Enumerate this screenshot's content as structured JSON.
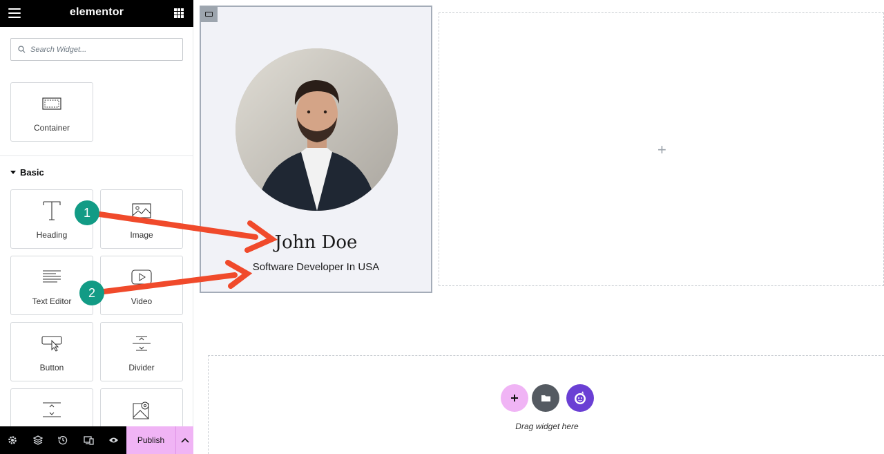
{
  "app": {
    "brand": "elementor"
  },
  "search": {
    "placeholder": "Search Widget..."
  },
  "layout_tiles": [
    {
      "label": "Container",
      "icon": "container-icon"
    }
  ],
  "basic_section": {
    "title": "Basic",
    "tiles": [
      {
        "label": "Heading",
        "icon": "heading-icon"
      },
      {
        "label": "Image",
        "icon": "image-icon"
      },
      {
        "label": "Text Editor",
        "icon": "text-editor-icon"
      },
      {
        "label": "Video",
        "icon": "video-icon"
      },
      {
        "label": "Button",
        "icon": "button-icon"
      },
      {
        "label": "Divider",
        "icon": "divider-icon"
      },
      {
        "label": "",
        "icon": "spacer-icon"
      },
      {
        "label": "",
        "icon": "google-maps-icon"
      }
    ]
  },
  "bottom_bar": {
    "icons": [
      "settings-icon",
      "navigator-icon",
      "history-icon",
      "responsive-icon",
      "preview-icon"
    ],
    "publish_label": "Publish"
  },
  "canvas": {
    "card": {
      "name": "John Doe",
      "subtitle": "Software Developer In USA"
    },
    "empty_column_icon": "plus-icon",
    "dropzone": {
      "text": "Drag widget here"
    }
  },
  "annotations": [
    {
      "number": "1"
    },
    {
      "number": "2"
    }
  ],
  "colors": {
    "topbar": "#000000",
    "publish": "#f0b4f5",
    "badge": "#129b85",
    "arrow": "#f04a2b",
    "ai_button": "#6a3fd4"
  }
}
